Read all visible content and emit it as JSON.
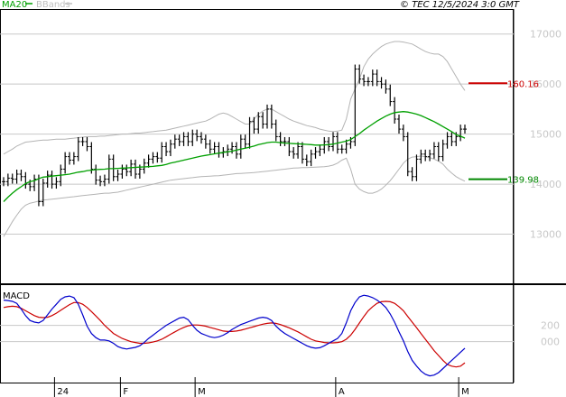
{
  "chart_data": {
    "type": "stock",
    "header": {
      "ma_label": "MA20",
      "bands_label": "BBands",
      "copyright": "© TEC 12/5/2024 3:0 GMT"
    },
    "price_panel": {
      "ylim": [
        12000,
        17500
      ],
      "y_ticks": [
        {
          "value": 17000,
          "label": "17000"
        },
        {
          "value": 16000,
          "label": "16000"
        },
        {
          "value": 15000,
          "label": "15000"
        },
        {
          "value": 14000,
          "label": "14000"
        },
        {
          "value": 13000,
          "label": "13000"
        }
      ],
      "levels": [
        {
          "name": "resistance",
          "value": 16016,
          "label": "160.16",
          "color": "#cc0000"
        },
        {
          "name": "support",
          "value": 14098,
          "label": "139.98",
          "color": "#008800"
        }
      ],
      "close": [
        14050,
        14120,
        14100,
        14200,
        14150,
        14000,
        13950,
        14100,
        13650,
        14020,
        14180,
        14000,
        14050,
        14300,
        14550,
        14480,
        14550,
        14850,
        14850,
        14750,
        14300,
        14080,
        14050,
        14100,
        14500,
        14150,
        14200,
        14300,
        14250,
        14400,
        14200,
        14300,
        14420,
        14500,
        14550,
        14520,
        14750,
        14650,
        14800,
        14900,
        14850,
        14950,
        14850,
        15000,
        14950,
        14900,
        14800,
        14700,
        14750,
        14620,
        14650,
        14700,
        14750,
        14600,
        14900,
        14800,
        15250,
        15100,
        15350,
        15200,
        15500,
        15200,
        14950,
        14850,
        14850,
        14650,
        14600,
        14750,
        14500,
        14450,
        14600,
        14650,
        14700,
        14850,
        14750,
        14950,
        14700,
        14700,
        14800,
        14850,
        16300,
        16100,
        16050,
        16050,
        16200,
        16050,
        16000,
        15900,
        15650,
        15300,
        15100,
        14950,
        14250,
        14150,
        14500,
        14600,
        14550,
        14600,
        14750,
        14550,
        14800,
        14950,
        14850,
        14950,
        15100,
        15100
      ],
      "ma20": [
        13650,
        13740,
        13820,
        13890,
        13950,
        14010,
        14050,
        14070,
        14110,
        14140,
        14150,
        14160,
        14170,
        14180,
        14190,
        14200,
        14220,
        14240,
        14250,
        14270,
        14280,
        14290,
        14295,
        14300,
        14310,
        14310,
        14315,
        14320,
        14325,
        14330,
        14335,
        14340,
        14345,
        14350,
        14355,
        14365,
        14375,
        14395,
        14420,
        14440,
        14460,
        14480,
        14500,
        14520,
        14540,
        14560,
        14575,
        14590,
        14605,
        14620,
        14635,
        14645,
        14660,
        14680,
        14700,
        14720,
        14740,
        14760,
        14790,
        14810,
        14830,
        14840,
        14840,
        14830,
        14820,
        14815,
        14810,
        14805,
        14800,
        14795,
        14790,
        14780,
        14780,
        14785,
        14790,
        14800,
        14820,
        14840,
        14860,
        14890,
        14950,
        15010,
        15080,
        15140,
        15200,
        15260,
        15310,
        15360,
        15400,
        15430,
        15440,
        15450,
        15440,
        15420,
        15400,
        15370,
        15330,
        15290,
        15250,
        15200,
        15150,
        15100,
        15050,
        14990,
        14960,
        14920
      ],
      "bb_upper": [
        14600,
        14650,
        14700,
        14760,
        14800,
        14840,
        14850,
        14860,
        14870,
        14880,
        14880,
        14890,
        14900,
        14900,
        14900,
        14910,
        14920,
        14930,
        14940,
        14950,
        14950,
        14950,
        14960,
        14960,
        14970,
        14980,
        14990,
        15000,
        15000,
        15010,
        15020,
        15020,
        15030,
        15040,
        15050,
        15060,
        15070,
        15080,
        15100,
        15120,
        15140,
        15160,
        15180,
        15200,
        15220,
        15240,
        15260,
        15300,
        15350,
        15400,
        15420,
        15400,
        15350,
        15300,
        15250,
        15200,
        15200,
        15300,
        15400,
        15460,
        15500,
        15500,
        15450,
        15400,
        15350,
        15300,
        15260,
        15230,
        15200,
        15170,
        15150,
        15130,
        15100,
        15080,
        15060,
        15050,
        15060,
        15080,
        15300,
        15700,
        15900,
        16100,
        16350,
        16500,
        16600,
        16680,
        16750,
        16800,
        16830,
        16850,
        16850,
        16840,
        16820,
        16800,
        16750,
        16700,
        16650,
        16620,
        16600,
        16600,
        16550,
        16450,
        16300,
        16150,
        16000,
        15870
      ],
      "bb_lower": [
        12950,
        13100,
        13250,
        13380,
        13500,
        13580,
        13620,
        13640,
        13660,
        13680,
        13690,
        13700,
        13710,
        13720,
        13730,
        13740,
        13750,
        13760,
        13770,
        13780,
        13790,
        13800,
        13810,
        13820,
        13820,
        13830,
        13840,
        13860,
        13880,
        13900,
        13920,
        13940,
        13960,
        13980,
        14000,
        14020,
        14040,
        14060,
        14080,
        14090,
        14100,
        14110,
        14120,
        14130,
        14140,
        14150,
        14155,
        14160,
        14165,
        14170,
        14180,
        14190,
        14200,
        14210,
        14215,
        14220,
        14225,
        14230,
        14240,
        14250,
        14260,
        14270,
        14280,
        14290,
        14300,
        14310,
        14320,
        14325,
        14330,
        14330,
        14335,
        14340,
        14345,
        14350,
        14360,
        14380,
        14420,
        14480,
        14520,
        14300,
        14000,
        13900,
        13850,
        13820,
        13820,
        13850,
        13900,
        13980,
        14070,
        14180,
        14300,
        14420,
        14500,
        14540,
        14550,
        14560,
        14550,
        14530,
        14500,
        14460,
        14400,
        14300,
        14220,
        14150,
        14100,
        14060
      ]
    },
    "macd_panel": {
      "y_ticks": [
        {
          "value": 200,
          "label": "200"
        },
        {
          "value": 0,
          "label": "000"
        }
      ],
      "ylim": [
        -480,
        650
      ],
      "title": "MACD",
      "macd": [
        510,
        505,
        495,
        470,
        400,
        320,
        260,
        240,
        230,
        260,
        330,
        400,
        460,
        520,
        550,
        560,
        540,
        460,
        330,
        190,
        100,
        50,
        20,
        20,
        10,
        -20,
        -60,
        -80,
        -90,
        -80,
        -70,
        -50,
        -10,
        40,
        80,
        120,
        160,
        200,
        230,
        260,
        290,
        300,
        270,
        200,
        140,
        100,
        80,
        60,
        50,
        60,
        80,
        110,
        150,
        180,
        210,
        230,
        250,
        270,
        290,
        300,
        290,
        260,
        190,
        140,
        100,
        70,
        40,
        10,
        -20,
        -50,
        -70,
        -80,
        -75,
        -50,
        -20,
        10,
        40,
        100,
        230,
        380,
        480,
        550,
        570,
        560,
        540,
        510,
        470,
        420,
        340,
        240,
        120,
        10,
        -120,
        -230,
        -300,
        -360,
        -400,
        -420,
        -410,
        -380,
        -330,
        -280,
        -230,
        -180,
        -130,
        -80
      ],
      "signal": [
        420,
        430,
        435,
        430,
        410,
        380,
        350,
        320,
        300,
        295,
        300,
        320,
        350,
        385,
        420,
        455,
        480,
        480,
        460,
        420,
        370,
        315,
        260,
        200,
        150,
        100,
        70,
        40,
        20,
        0,
        -10,
        -20,
        -20,
        -15,
        -5,
        10,
        30,
        60,
        90,
        120,
        150,
        175,
        195,
        205,
        205,
        200,
        190,
        175,
        160,
        145,
        130,
        125,
        125,
        130,
        140,
        155,
        170,
        185,
        200,
        215,
        225,
        230,
        225,
        210,
        190,
        170,
        145,
        120,
        90,
        60,
        30,
        10,
        0,
        -10,
        -15,
        -15,
        -10,
        0,
        30,
        80,
        150,
        230,
        310,
        380,
        430,
        470,
        490,
        495,
        490,
        470,
        430,
        380,
        310,
        240,
        170,
        100,
        30,
        -40,
        -110,
        -170,
        -230,
        -280,
        -300,
        -310,
        -300,
        -260
      ]
    },
    "x_labels": [
      {
        "index": 12,
        "label": "24"
      },
      {
        "index": 27,
        "label": "F"
      },
      {
        "index": 44,
        "label": "M"
      },
      {
        "index": 76,
        "label": "A"
      },
      {
        "index": 104,
        "label": "M"
      }
    ],
    "colors": {
      "bars": "#000000",
      "ma20": "#00a000",
      "bbands": "#b4b4b4",
      "macd": "#0000cc",
      "signal": "#cc0000",
      "grid": "#c8c8c8"
    }
  }
}
